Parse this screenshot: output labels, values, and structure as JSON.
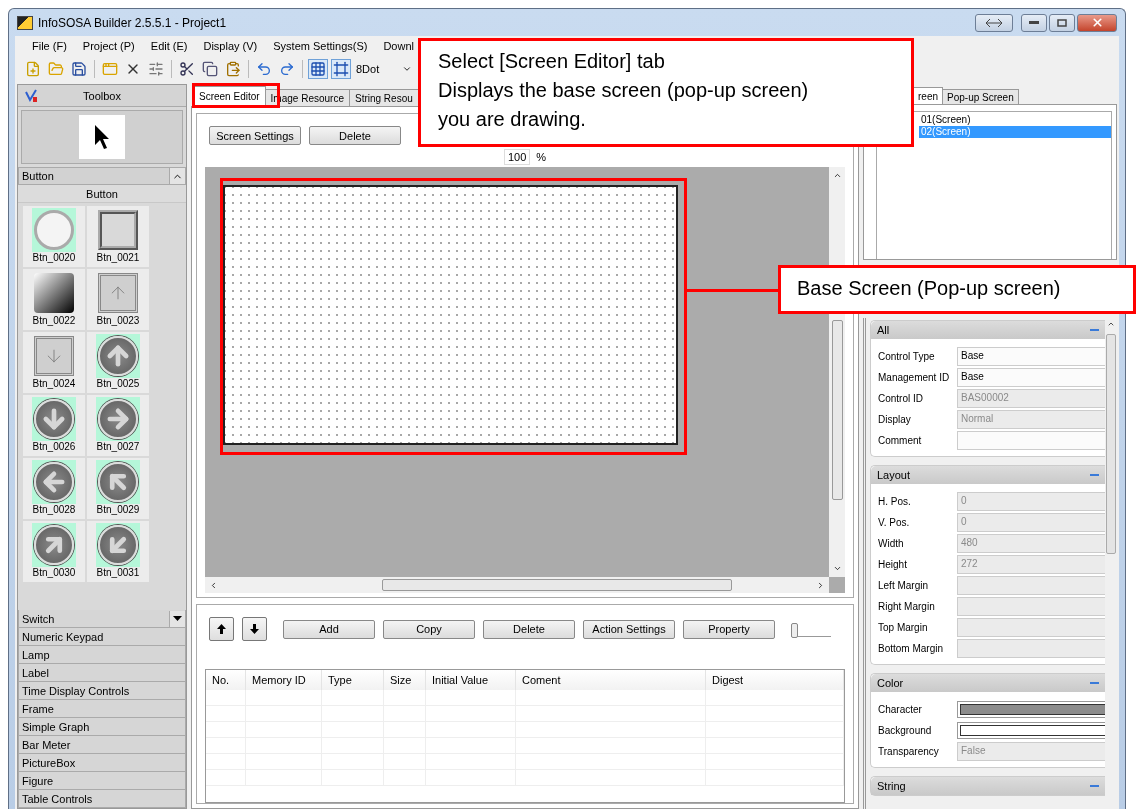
{
  "window": {
    "title": "InfoSOSA Builder 2.5.5.1 - Project1"
  },
  "menu": [
    "File (F)",
    "Project (P)",
    "Edit (E)",
    "Display (V)",
    "System Settings(S)",
    "Downl"
  ],
  "toolbar": {
    "grid_size": "8Dot"
  },
  "toolbox": {
    "title": "Toolbox",
    "group": "Button",
    "subgroup": "Button",
    "items": [
      "Btn_0020",
      "Btn_0021",
      "Btn_0022",
      "Btn_0023",
      "Btn_0024",
      "Btn_0025",
      "Btn_0026",
      "Btn_0027",
      "Btn_0028",
      "Btn_0029",
      "Btn_0030",
      "Btn_0031"
    ],
    "categories": [
      "Switch",
      "Numeric Keypad",
      "Lamp",
      "Label",
      "Time Display Controls",
      "Frame",
      "Simple Graph",
      "Bar Meter",
      "PictureBox",
      "Figure",
      "Table Controls"
    ]
  },
  "editor_tabs": [
    {
      "label": "Screen Editor",
      "selected": true
    },
    {
      "label": "Image Resource",
      "selected": false
    },
    {
      "label": "String Resou",
      "selected": false
    }
  ],
  "editor": {
    "buttons": [
      "Screen Settings",
      "Delete"
    ],
    "zoom": "100",
    "zoom_unit": "%"
  },
  "memory": {
    "buttons": [
      "Add",
      "Copy",
      "Delete",
      "Action Settings",
      "Property"
    ],
    "slider": {
      "level": 0
    },
    "columns": [
      "No.",
      "Memory ID",
      "Type",
      "Size",
      "Initial Value",
      "Coment",
      "Digest"
    ]
  },
  "screen_tabs": [
    {
      "label": "reen",
      "selected": true
    },
    {
      "label": "Pop-up Screen",
      "selected": false
    }
  ],
  "screens": [
    {
      "label": "01(Screen)",
      "selected": false
    },
    {
      "label": "02(Screen)",
      "selected": true
    }
  ],
  "properties": [
    {
      "title": "All",
      "rows": [
        {
          "kind": "text",
          "label": "Control Type",
          "value": "Base",
          "disabled": false
        },
        {
          "kind": "text",
          "label": "Management ID",
          "value": "Base",
          "disabled": false
        },
        {
          "kind": "text",
          "label": "Control ID",
          "value": "BAS00002",
          "disabled": true
        },
        {
          "kind": "text",
          "label": "Display",
          "value": "Normal",
          "disabled": true
        },
        {
          "kind": "text",
          "label": "Comment",
          "disabled": false
        }
      ]
    },
    {
      "title": "Layout",
      "rows": [
        {
          "kind": "text",
          "label": "H. Pos.",
          "value": "0",
          "disabled": true
        },
        {
          "kind": "text",
          "label": "V. Pos.",
          "value": "0",
          "disabled": true
        },
        {
          "kind": "text",
          "label": "Width",
          "value": "480",
          "disabled": true
        },
        {
          "kind": "text",
          "label": "Height",
          "value": "272",
          "disabled": true
        },
        {
          "kind": "text",
          "label": "Left Margin",
          "disabled": true
        },
        {
          "kind": "text",
          "label": "Right Margin",
          "disabled": true
        },
        {
          "kind": "text",
          "label": "Top Margin",
          "disabled": true
        },
        {
          "kind": "text",
          "label": "Bottom Margin",
          "disabled": true
        }
      ]
    },
    {
      "title": "Color",
      "rows": [
        {
          "kind": "color",
          "label": "Character",
          "color": "#8c8c8c"
        },
        {
          "kind": "color",
          "label": "Background",
          "color": "#ffffff"
        },
        {
          "kind": "text",
          "label": "Transparency",
          "value": "False",
          "disabled": true
        }
      ]
    },
    {
      "title": "String"
    }
  ],
  "callouts": [
    {
      "lines": [
        "Select [Screen Editor] tab",
        "Displays the base screen (pop-up screen)",
        "you are drawing."
      ]
    },
    {
      "lines": [
        "Base Screen (Pop-up screen)"
      ]
    }
  ]
}
